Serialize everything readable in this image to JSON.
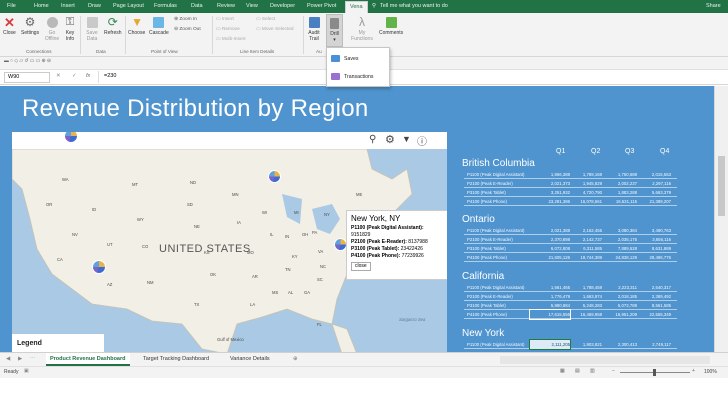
{
  "ribbon_tabs": [
    "File",
    "Home",
    "Insert",
    "Draw",
    "Page Layout",
    "Formulas",
    "Data",
    "Review",
    "View",
    "Developer",
    "Power Pivot",
    "Vena"
  ],
  "tell_me": "Tell me what you want to do",
  "share": "Share",
  "ribbon": {
    "buttons": {
      "close": "Close",
      "settings": "Settings",
      "go_offline": "Go Offline",
      "key_info": "Key Info",
      "save_data": "Save Data",
      "refresh": "Refresh",
      "choose": "Choose",
      "cascade": "Cascade",
      "audit_trail": "Audit Trail",
      "drill": "Drill",
      "my_functions": "My Functions",
      "comments": "Comments"
    },
    "small": {
      "zoom_in": "Zoom In",
      "zoom_out": "Zoom Out",
      "insert": "Insert",
      "remove": "Remove",
      "multi_insert": "Multi-Insert",
      "select": "Select",
      "move_selected": "Move Selected"
    },
    "groups": {
      "connections": "Connections",
      "data": "Data",
      "point_of_view": "Point of View",
      "line_item_details": "Line Item Details",
      "audit": "Au"
    }
  },
  "drill_menu": [
    "Saves",
    "Transactions"
  ],
  "formula_bar": {
    "name_box": "W90",
    "fx": "fx",
    "formula": "=230"
  },
  "dashboard": {
    "title": "Revenue Distribution by Region",
    "quarters": [
      "Q1",
      "Q2",
      "Q3",
      "Q4"
    ],
    "regions": [
      {
        "name": "British Columbia",
        "rows": [
          [
            "P1100 (Peak Digital Assistant)",
            "1,866,388",
            "1,789,168",
            "1,750,688",
            "2,015,553"
          ],
          [
            "P2100 (Peak E-Reader)",
            "2,021,373",
            "1,945,829",
            "2,002,237",
            "2,297,116"
          ],
          [
            "P3100 (Peak Tablet)",
            "3,251,932",
            "4,720,790",
            "1,883,288",
            "5,663,379"
          ],
          [
            "P4100 (Peak Phone)",
            "23,281,386",
            "16,078,661",
            "16,531,115",
            "21,389,207"
          ]
        ]
      },
      {
        "name": "Ontario",
        "rows": [
          [
            "P1100 (Peak Digital Assistant)",
            "2,021,388",
            "2,162,455",
            "3,080,384",
            "3,490,763"
          ],
          [
            "P2100 (Peak E-Reader)",
            "2,370,898",
            "2,142,737",
            "2,035,175",
            "3,656,116"
          ],
          [
            "P3100 (Peak Tablet)",
            "6,072,808",
            "6,311,585",
            "7,889,528",
            "8,631,889"
          ],
          [
            "P4100 (Peak Phone)",
            "21,605,126",
            "19,744,389",
            "24,838,129",
            "28,496,776"
          ]
        ]
      },
      {
        "name": "California",
        "rows": [
          [
            "P1100 (Peak Digital Assistant)",
            "1,661,465",
            "1,788,459",
            "2,223,311",
            "2,540,317"
          ],
          [
            "P2100 (Peak E-Reader)",
            "1,776,479",
            "1,663,974",
            "2,018,185",
            "2,389,492"
          ],
          [
            "P3100 (Peak Tablet)",
            "5,990,884",
            "5,248,283",
            "5,073,789",
            "8,561,585"
          ],
          [
            "P4100 (Peak Phone)",
            "17,615,556",
            "16,469,958",
            "16,951,209",
            "22,555,349"
          ]
        ]
      },
      {
        "name": "New York",
        "rows": [
          [
            "P1100 (Peak Digital Assistant)",
            "2,111,205",
            "1,903,821",
            "2,300,413",
            "2,749,117"
          ]
        ]
      }
    ]
  },
  "map": {
    "country_label": "UNITED STATES",
    "legend": "Legend",
    "places": [
      "WA",
      "MT",
      "ND",
      "MN",
      "OR",
      "ID",
      "SD",
      "WY",
      "NE",
      "IA",
      "NV",
      "UT",
      "CO",
      "KS",
      "MO",
      "CA",
      "AZ",
      "NM",
      "OK",
      "AR",
      "TX",
      "LA",
      "IL",
      "IN",
      "OH",
      "MI",
      "WI",
      "KY",
      "TN",
      "MS",
      "AL",
      "GA",
      "SC",
      "NC",
      "VA",
      "PA",
      "NY",
      "ME",
      "FL",
      "Gulf of Mexico",
      "Gulf of Maine",
      "Sargasso Sea"
    ],
    "callout": {
      "title": "New York, NY",
      "p1100": "P1100 (Peak Digital Assistant):",
      "p1100_val": "9151829",
      "p2100": "P2100 (Peak E-Reader):",
      "p2100_val": "8137988",
      "p3100": "P3100 (Peak Tablet):",
      "p3100_val": "23422426",
      "p4100": "P4100 (Peak Phone):",
      "p4100_val": "77239926",
      "close": "close"
    }
  },
  "sheet_tabs": [
    "Product Revenue Dashboard",
    "Target Tracking Dashboard",
    "Variance Details"
  ],
  "status": {
    "ready": "Ready",
    "zoom": "100%"
  }
}
